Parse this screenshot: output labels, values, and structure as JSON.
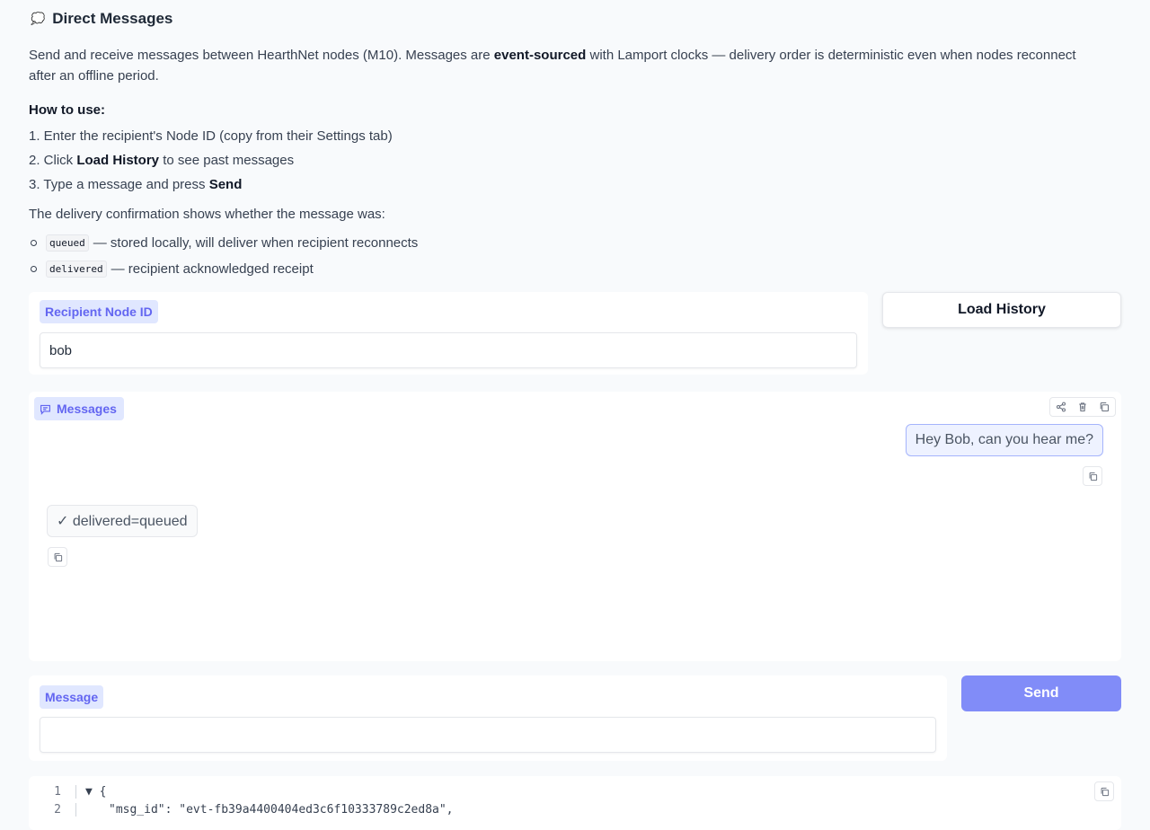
{
  "header": {
    "icon": "speech-bubble-icon",
    "emoji": "💭",
    "title": "Direct Messages"
  },
  "description": {
    "p1_a": "Send and receive messages between HearthNet nodes (M10). Messages are ",
    "p1_bold": "event-sourced",
    "p1_b": " with Lamport clocks — delivery order is deterministic even when nodes reconnect after an offline period.",
    "howto_title": "How to use:",
    "step1": "1. Enter the recipient's Node ID (copy from their Settings tab)",
    "step2_a": "2. Click ",
    "step2_bold": "Load History",
    "step2_b": " to see past messages",
    "step3_a": "3. Type a message and press ",
    "step3_bold": "Send",
    "confirm": "The delivery confirmation shows whether the message was:",
    "bullets": [
      {
        "code": "queued",
        "text": "— stored locally, will deliver when recipient reconnects"
      },
      {
        "code": "delivered",
        "text": "— recipient acknowledged receipt"
      }
    ]
  },
  "recipient": {
    "label": "Recipient Node ID",
    "value": "bob"
  },
  "load_history_label": "Load History",
  "chat": {
    "label": "Messages",
    "messages": [
      {
        "role": "user",
        "text": "Hey Bob, can you hear me?"
      },
      {
        "role": "bot",
        "text": "✓ delivered=queued"
      }
    ]
  },
  "message_input": {
    "label": "Message",
    "value": ""
  },
  "send_label": "Send",
  "code": {
    "lines": [
      {
        "n": "1",
        "text": "▼ {"
      },
      {
        "n": "2",
        "text": "\"msg_id\": \"evt-fb39a4400404ed3c6f10333789c2ed8a\","
      }
    ]
  },
  "colors": {
    "accent": "#6366f1",
    "accent_light": "#e0e7ff",
    "send_button": "#818cf8"
  }
}
